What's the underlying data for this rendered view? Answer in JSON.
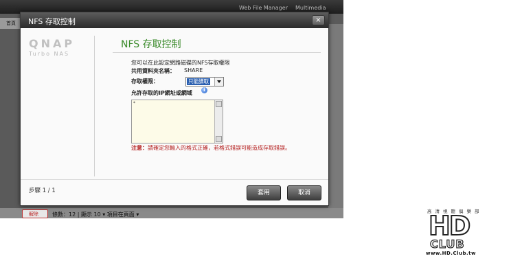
{
  "background": {
    "top_links": [
      "Web File Manager",
      "Multimedia Station"
    ],
    "nav_tab": "首頁",
    "bottom_delete": "解除",
    "bottom_text": "條數：12 | 顯示 10 ▾ 項目在頁面 ▾"
  },
  "dialog": {
    "title": "NFS 存取控制",
    "close_label": "×",
    "logo": {
      "brand": "QNAP",
      "sub": "Turbo NAS"
    },
    "heading": "NFS 存取控制",
    "description": "您可以在此設定網路磁碟的NFS存取權限",
    "share_label": "共用資料夾名稱：",
    "share_value": "SHARE",
    "access_label": "存取權限：",
    "access_selected": "只能讀取",
    "allowed_ip_label": "允許存取的IP網址或網域",
    "info_icon_text": "i",
    "textarea_value": "*",
    "note_prefix": "注意：",
    "note_text": "請確定您輸入的格式正確，若格式錯誤可能造成存取錯誤。",
    "step": "步驟 1 / 1",
    "apply_label": "套用",
    "cancel_label": "取消"
  },
  "watermark": {
    "top": "高清視聽俱樂部",
    "hd": "HD",
    "club": "CLUB",
    "url": "www.HD.Club.tw"
  },
  "colors": {
    "heading_green": "#3a8a2a",
    "note_red": "#b52222",
    "select_highlight": "#2a5fb0",
    "textarea_bg": "#fdfbe8"
  }
}
